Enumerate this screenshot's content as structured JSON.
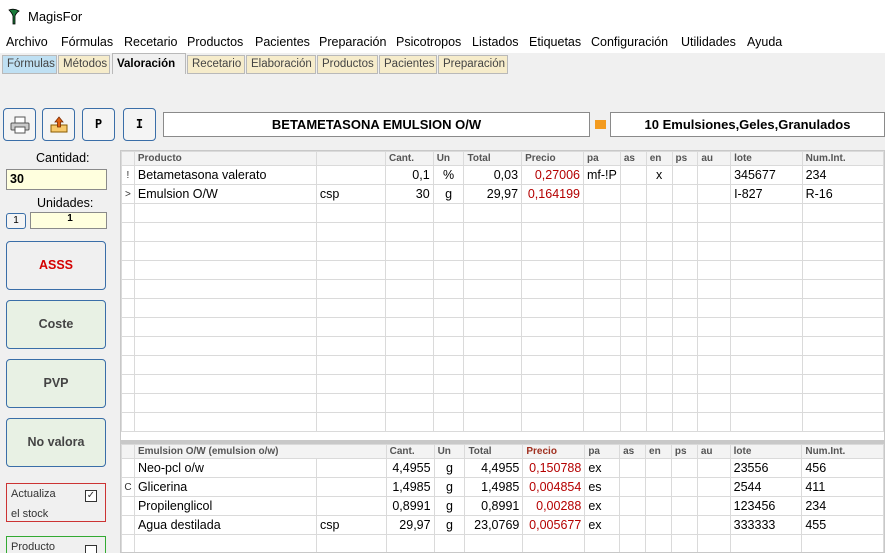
{
  "window": {
    "title": "MagisFor"
  },
  "menu": [
    "Archivo",
    "Fórmulas",
    "Recetario",
    "Productos",
    "Pacientes",
    "Preparación",
    "Psicotropos",
    "Listados",
    "Etiquetas",
    "Configuración",
    "Utilidades",
    "Ayuda"
  ],
  "tabs": [
    "Fórmulas",
    "Métodos",
    "Valoración",
    "Recetario",
    "Elaboración",
    "Productos",
    "Pacientes",
    "Preparación"
  ],
  "active_tab": "Valoración",
  "toolbar": {
    "p_label": "P",
    "i_label": "I",
    "formula_name": "BETAMETASONA EMULSION O/W",
    "category": "10 Emulsiones,Geles,Granulados"
  },
  "left_panel": {
    "cantidad_label": "Cantidad:",
    "cantidad_value": "30",
    "unidades_label": "Unidades:",
    "unidades_button": "1",
    "unidades_value": "1",
    "buttons": [
      "ASSS",
      "Coste",
      "PVP",
      "No valora"
    ],
    "actualiza_label": "Actualiza",
    "actualiza_label2": "el stock",
    "actualiza_checked": "✓",
    "producto_label": "Producto"
  },
  "columns": [
    "Producto",
    "",
    "Cant.",
    "Un",
    "Total",
    "Precio",
    "pa",
    "as",
    "en",
    "ps",
    "au",
    "lote",
    "Num.Int."
  ],
  "top_rows": [
    {
      "ind": "!",
      "producto": "Betametasona valerato",
      "extra": "",
      "cant": "0,1",
      "un": "%",
      "total": "0,03",
      "precio": "0,27006",
      "pa": "mf-!P",
      "as": "",
      "en": "x",
      "ps": "",
      "au": "",
      "lote": "345677",
      "numint": "234"
    },
    {
      "ind": ">",
      "producto": "Emulsion O/W",
      "extra": "csp",
      "cant": "30",
      "un": "g",
      "total": "29,97",
      "precio": "0,164199",
      "pa": "",
      "as": "",
      "en": "",
      "ps": "",
      "au": "",
      "lote": "I-827",
      "numint": "R-16"
    }
  ],
  "bottom_header": "Emulsion O/W (emulsion o/w)",
  "bottom_rows": [
    {
      "ind": "",
      "producto": "Neo-pcl o/w",
      "extra": "",
      "cant": "4,4955",
      "un": "g",
      "total": "4,4955",
      "precio": "0,150788",
      "pa": "ex",
      "as": "",
      "en": "",
      "ps": "",
      "au": "",
      "lote": "23556",
      "numint": "456"
    },
    {
      "ind": "C",
      "producto": "Glicerina",
      "extra": "",
      "cant": "1,4985",
      "un": "g",
      "total": "1,4985",
      "precio": "0,004854",
      "pa": "es",
      "as": "",
      "en": "",
      "ps": "",
      "au": "",
      "lote": "2544",
      "numint": "411"
    },
    {
      "ind": "",
      "producto": "Propilenglicol",
      "extra": "",
      "cant": "0,8991",
      "un": "g",
      "total": "0,8991",
      "precio": "0,00288",
      "pa": "ex",
      "as": "",
      "en": "",
      "ps": "",
      "au": "",
      "lote": "123456",
      "numint": "234"
    },
    {
      "ind": "",
      "producto": "Agua destilada",
      "extra": "csp",
      "cant": "29,97",
      "un": "g",
      "total": "23,0769",
      "precio": "0,005677",
      "pa": "ex",
      "as": "",
      "en": "",
      "ps": "",
      "au": "",
      "lote": "333333",
      "numint": "455"
    }
  ],
  "colors": {
    "accent_blue": "#3a6ea8",
    "price_red": "#b40000",
    "marker_orange": "#f39b1f"
  }
}
